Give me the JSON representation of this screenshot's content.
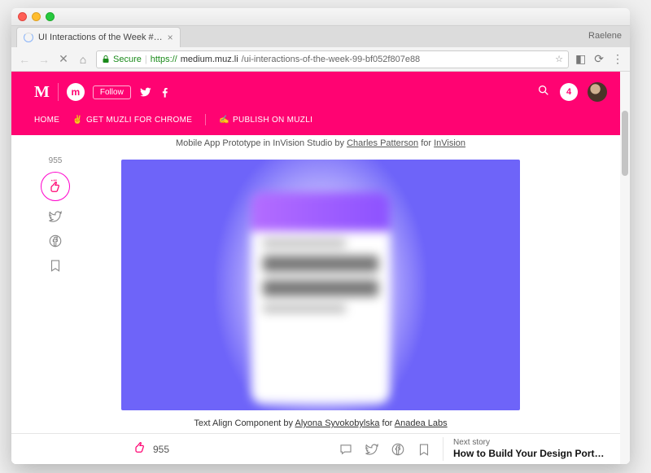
{
  "browser": {
    "tab_title": "UI Interactions of the Week #…",
    "profile_name": "Raelene",
    "url": {
      "secure_label": "Secure",
      "scheme": "https://",
      "host": "medium.muz.li",
      "path": "/ui-interactions-of-the-week-99-bf052f807e88"
    }
  },
  "header": {
    "logo_letter": "M",
    "muzli_letter": "m",
    "follow_label": "Follow",
    "notif_count": "4",
    "nav": {
      "home": "HOME",
      "get": "GET MUZLI FOR CHROME",
      "publish": "PUBLISH ON MUZLI"
    }
  },
  "article": {
    "left_rail_claps": "955",
    "prev_caption": {
      "prefix": "Mobile App Prototype in InVision Studio by ",
      "author": "Charles Patterson",
      "middle": " for ",
      "company": "InVision"
    },
    "caption": {
      "prefix": "Text Align Component by ",
      "author": "Alyona Syvokobylska",
      "middle": " for ",
      "company": "Anadea Labs"
    }
  },
  "bottom_bar": {
    "claps": "955",
    "next_label": "Next story",
    "next_title": "How to Build Your Design Port…"
  }
}
